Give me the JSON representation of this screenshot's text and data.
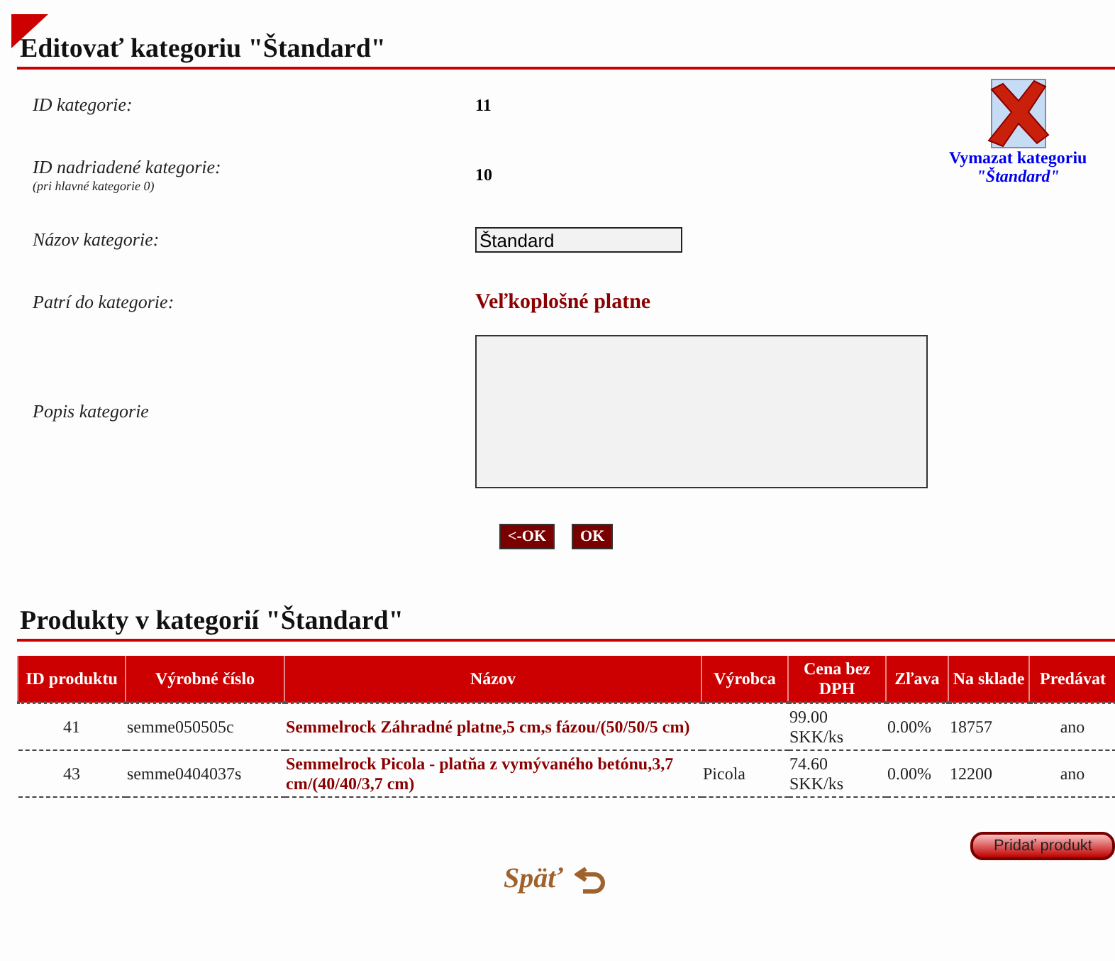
{
  "page_title": "Editovať kategoriu \"Štandard\"",
  "delete_link": {
    "line1": "Vymazat kategoriu",
    "line2": "\"Štandard\""
  },
  "form": [
    {
      "kind": "text",
      "label": "ID kategorie:",
      "value": "11"
    },
    {
      "kind": "text",
      "label": "ID nadriadené kategorie:",
      "note": "(pri hlavné kategorie 0)",
      "value": "10"
    },
    {
      "kind": "input",
      "label": "Názov kategorie:",
      "value": "Štandard"
    },
    {
      "kind": "link",
      "label": "Patrí do kategorie:",
      "value": "Veľkoplošné platne"
    },
    {
      "kind": "textarea",
      "label": "Popis kategorie"
    }
  ],
  "buttons": [
    "<-OK",
    "OK"
  ],
  "products_title": "Produkty v kategorií \"Štandard\"",
  "table": {
    "columns": [
      "ID produktu",
      "Výrobné číslo",
      "Názov",
      "Výrobca",
      "Cena bez DPH",
      "Zľava",
      "Na sklade",
      "Predávat"
    ],
    "rows": [
      {
        "cells": [
          "41",
          "semme050505c",
          "Semmelrock Záhradné platne,5 cm,s fázou/(50/50/5 cm)",
          "",
          "99.00 SKK/ks",
          "0.00%",
          "18757",
          "ano"
        ]
      },
      {
        "cells": [
          "43",
          "semme0404037s",
          "Semmelrock Picola - platňa z vymývaného betónu,3,7 cm/(40/40/3,7 cm)",
          "Picola",
          "74.60 SKK/ks",
          "0.00%",
          "12200",
          "ano"
        ]
      }
    ]
  },
  "add_button": "Pridať produkt",
  "back_link": "Späť"
}
